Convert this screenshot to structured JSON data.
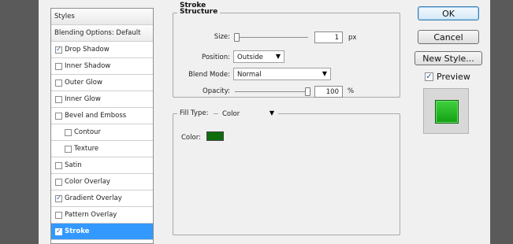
{
  "style_list": {
    "header": "Styles",
    "items": [
      {
        "label": "Blending Options: Default",
        "kind": "blend"
      },
      {
        "label": "Drop Shadow",
        "checked": true
      },
      {
        "label": "Inner Shadow",
        "checked": false
      },
      {
        "label": "Outer Glow",
        "checked": false
      },
      {
        "label": "Inner Glow",
        "checked": false
      },
      {
        "label": "Bevel and Emboss",
        "checked": false
      },
      {
        "label": "Contour",
        "checked": false,
        "sub": true
      },
      {
        "label": "Texture",
        "checked": false,
        "sub": true
      },
      {
        "label": "Satin",
        "checked": false
      },
      {
        "label": "Color Overlay",
        "checked": false
      },
      {
        "label": "Gradient Overlay",
        "checked": true
      },
      {
        "label": "Pattern Overlay",
        "checked": false
      },
      {
        "label": "Stroke",
        "checked": true,
        "selected": true
      }
    ]
  },
  "stroke": {
    "title": "Stroke",
    "structure_legend": "Structure",
    "size_label": "Size:",
    "size_value": "1",
    "size_unit": "px",
    "position_label": "Position:",
    "position_value": "Outside",
    "blend_label": "Blend Mode:",
    "blend_value": "Normal",
    "opacity_label": "Opacity:",
    "opacity_value": "100",
    "opacity_unit": "%",
    "fill_type_label": "Fill Type:",
    "fill_type_value": "Color",
    "color_label": "Color:",
    "color_hex": "#0e6e0e"
  },
  "buttons": {
    "ok": "OK",
    "cancel": "Cancel",
    "new_style": "New Style..."
  },
  "preview": {
    "label": "Preview",
    "checked": true
  },
  "glyphs": {
    "check": "✓",
    "dropdown_arrow": "▼"
  }
}
